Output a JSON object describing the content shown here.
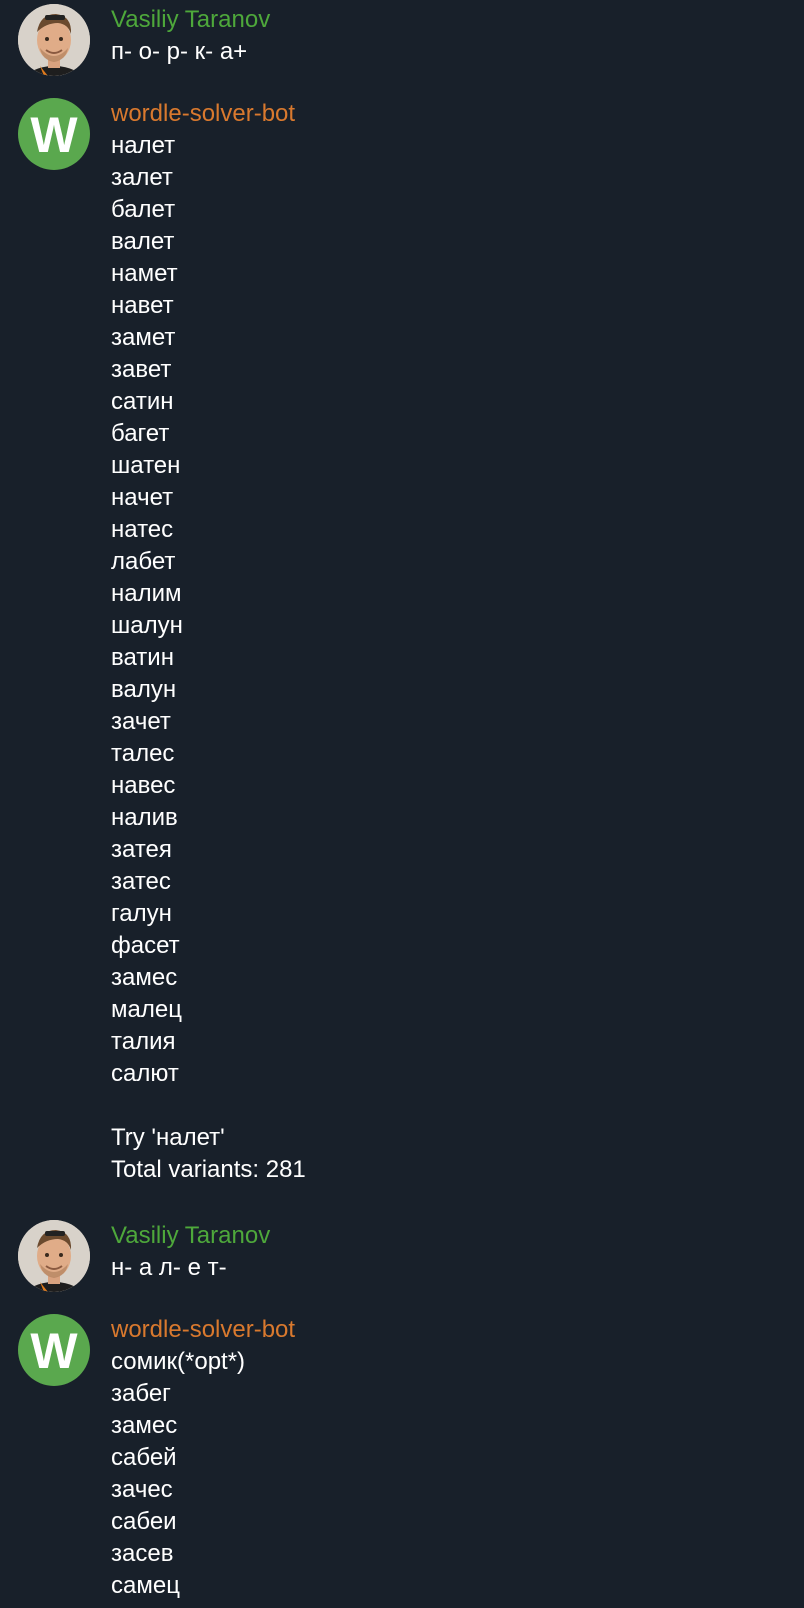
{
  "messages": [
    {
      "sender": "Vasiliy Taranov",
      "lines": [
        "п- о- р- к- а+"
      ]
    },
    {
      "sender": "wordle-solver-bot",
      "avatar_letter": "W",
      "lines": [
        "налет",
        "залет",
        "балет",
        "валет",
        "намет",
        "навет",
        "замет",
        "завет",
        "сатин",
        "багет",
        "шатен",
        "начет",
        "натес",
        "лабет",
        "налим",
        "шалун",
        "ватин",
        "валун",
        "зачет",
        "талес",
        "навес",
        "налив",
        "затея",
        "затес",
        "галун",
        "фасет",
        "замес",
        "малец",
        "талия",
        "салют"
      ],
      "suggestion": "Try 'налет'",
      "total": "Total variants: 281"
    },
    {
      "sender": "Vasiliy Taranov",
      "lines": [
        "н- а л- е т-"
      ]
    },
    {
      "sender": "wordle-solver-bot",
      "avatar_letter": "W",
      "lines": [
        "сомик(*opt*)",
        "забег",
        "замес",
        "сабей",
        "зачес",
        "сабеи",
        "засев",
        "самец"
      ]
    }
  ],
  "colors": {
    "background": "#18202a",
    "user_name": "#4ea83b",
    "bot_name": "#d9792e",
    "bot_avatar": "#5aa84e"
  }
}
